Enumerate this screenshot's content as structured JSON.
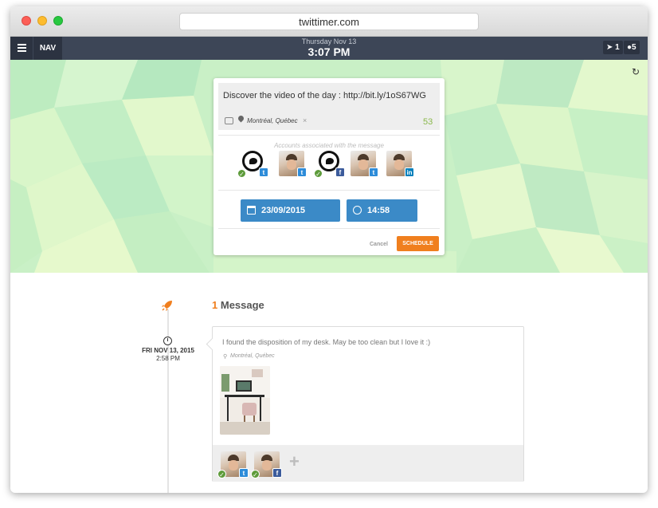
{
  "browser": {
    "url": "twittimer.com"
  },
  "topbar": {
    "nav_label": "NAV",
    "date": "Thursday Nov 13",
    "time": "3:07 PM",
    "badge_sent": "1",
    "badge_users": "5"
  },
  "composer": {
    "message": "Discover the video of the day : http://bit.ly/1oS67WG",
    "location": "Montréal, Québec",
    "remove_location": "×",
    "char_count": "53",
    "accounts_label": "Accounts associated with the message",
    "accounts": [
      {
        "type": "twitter-logo",
        "network": "twitter",
        "net_glyph": "t",
        "selected": true
      },
      {
        "type": "photo",
        "network": "twitter",
        "net_glyph": "t",
        "selected": false
      },
      {
        "type": "twitter-logo",
        "network": "facebook",
        "net_glyph": "f",
        "selected": true
      },
      {
        "type": "photo",
        "network": "twitter",
        "net_glyph": "t",
        "selected": false
      },
      {
        "type": "photo",
        "network": "linkedin",
        "net_glyph": "in",
        "selected": false
      }
    ],
    "date_value": "23/09/2015",
    "time_value": "14:58",
    "cancel_label": "Cancel",
    "schedule_label": "SCHEDULE"
  },
  "messages": {
    "count": "1",
    "title": "Message",
    "items": [
      {
        "date": "FRI NOV 13, 2015",
        "time": "2:58 PM",
        "text": "I found the disposition of my desk. May be too clean but I love it :)",
        "location": "Montréal, Québec",
        "add_label": "+"
      }
    ]
  },
  "colors": {
    "accent": "#f07f1e",
    "primary_button": "#3b8ac7",
    "topbar": "#3d4657",
    "count_green": "#8ab84b"
  }
}
